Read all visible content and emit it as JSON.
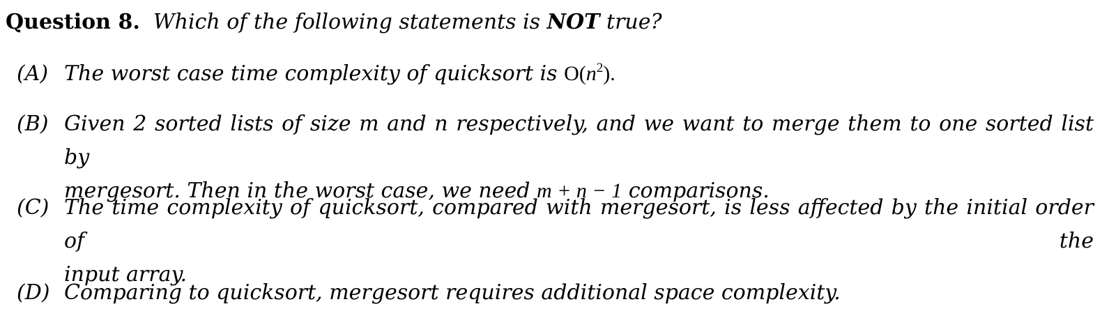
{
  "question": {
    "label": "Question 8.",
    "text_before": "Which of the following statements is",
    "emphasis": "NOT",
    "text_after": "true?"
  },
  "options": {
    "a": {
      "letter": "(A)",
      "text": "The worst case time complexity of quicksort is",
      "math_open": "O(",
      "math_var": "n",
      "math_exp": "2",
      "math_close": ").",
      "math": "O(n²)."
    },
    "b": {
      "letter": "(B)",
      "line1": "Given 2 sorted lists of size m and n respectively, and we want to merge them to one sorted list by",
      "line2_before": "mergesort. Then in the worst case, we need",
      "line2_math": "m + n − 1",
      "line2_after": "comparisons."
    },
    "c": {
      "letter": "(C)",
      "line1": "The time complexity of quicksort, compared with mergesort, is less affected by the initial order of the",
      "line2": "input array."
    },
    "d": {
      "letter": "(D)",
      "text": "Comparing to quicksort, mergesort requires additional space complexity."
    }
  }
}
